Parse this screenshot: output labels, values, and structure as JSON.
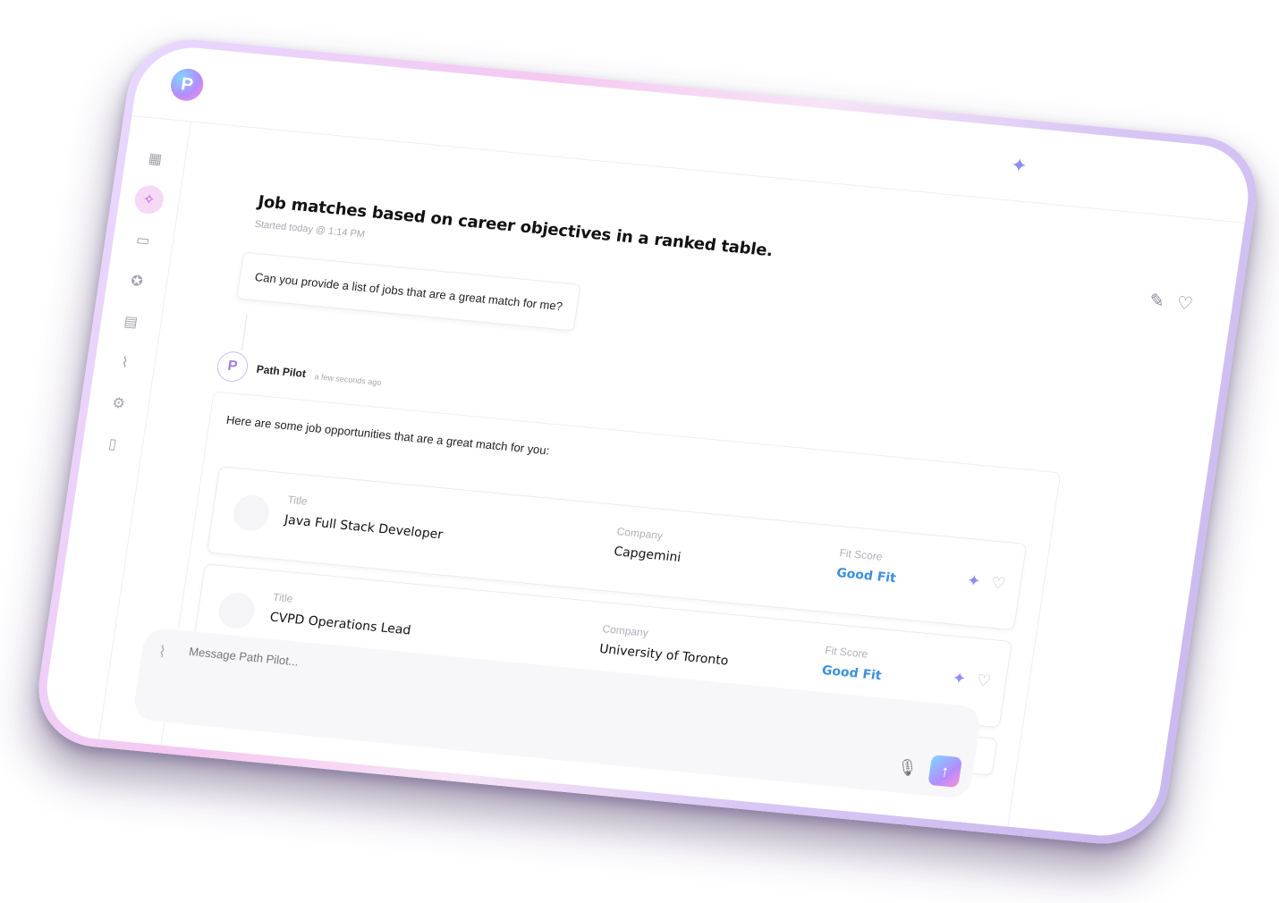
{
  "app": {
    "logo_letter": "P",
    "sidebar_icons": [
      "grid-icon",
      "sparkle-pin-icon",
      "briefcase-icon",
      "award-icon",
      "card-check-icon",
      "paperclip-icon",
      "gear-icon",
      "panel-icon"
    ]
  },
  "chat": {
    "title": "Job matches based on career objectives in a ranked table.",
    "started": "Started today @ 1:14 PM",
    "user_message": "Can you provide a list of jobs that are a great match for me?",
    "bot": {
      "name": "Path Pilot",
      "time": "a few seconds ago",
      "intro": "Here are some job opportunities that are a great match for you:"
    },
    "jobs": [
      {
        "title_label": "Title",
        "title": "Java Full Stack Developer",
        "company_label": "Company",
        "company": "Capgemini",
        "fit_label": "Fit Score",
        "fit": "Good Fit"
      },
      {
        "title_label": "Title",
        "title": "CVPD Operations Lead",
        "company_label": "Company",
        "company": "University of Toronto",
        "fit_label": "Fit Score",
        "fit": "Good Fit"
      }
    ]
  },
  "composer": {
    "placeholder": "Message Path Pilot..."
  },
  "colors": {
    "accent": "#b38cff",
    "fit": "#3c8fe0",
    "active_nav_bg": "#f6d9f7"
  }
}
